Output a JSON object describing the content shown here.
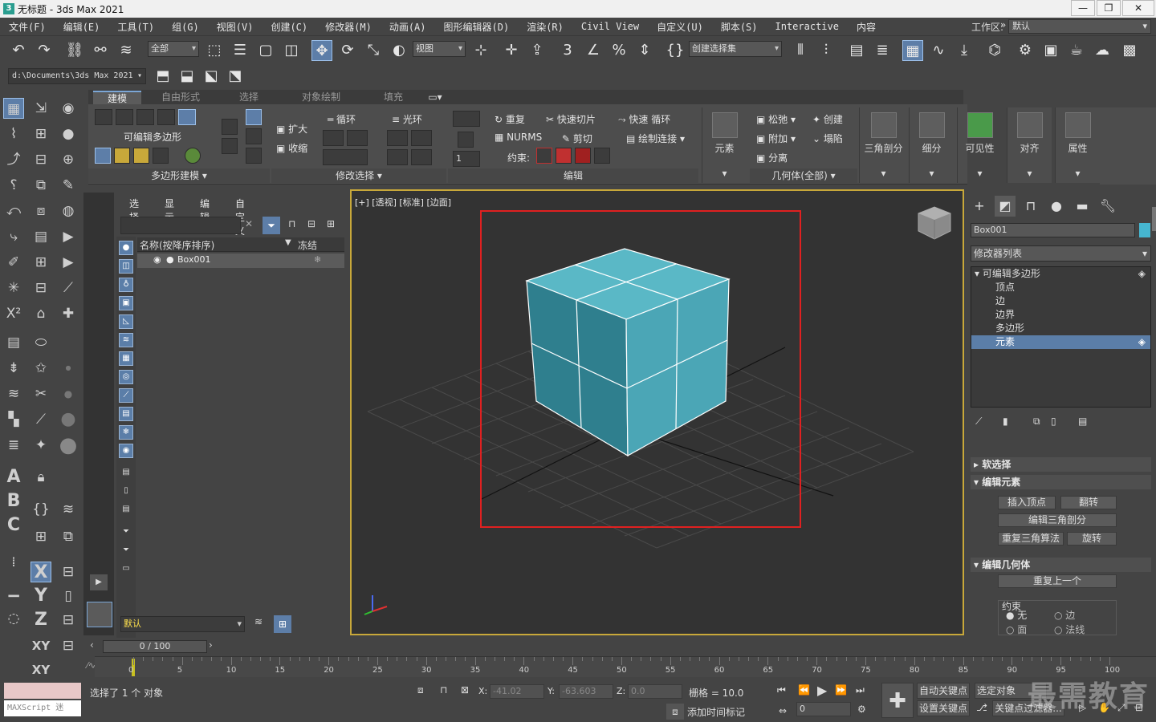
{
  "window": {
    "title": "无标题 - 3ds Max 2021",
    "minimize": "—",
    "maximize": "❐",
    "close": "✕"
  },
  "menu": {
    "items": [
      "文件(F)",
      "编辑(E)",
      "工具(T)",
      "组(G)",
      "视图(V)",
      "创建(C)",
      "修改器(M)",
      "动画(A)",
      "图形编辑器(D)",
      "渲染(R)",
      "Civil View",
      "自定义(U)",
      "脚本(S)",
      "Interactive",
      "内容"
    ],
    "more": "»",
    "workspace_label": "工作区:",
    "workspace_value": "默认"
  },
  "toolbar": {
    "selection_filter": "全部",
    "ref_coord": "视图",
    "named_selection": "创建选择集",
    "project_path": "d:\\Documents\\3ds Max 2021"
  },
  "ribbon": {
    "tabs": [
      "建模",
      "自由形式",
      "选择",
      "对象绘制",
      "填充"
    ],
    "active_tab": "建模",
    "editable_poly": "可编辑多边形",
    "panels": {
      "poly_modeling": "多边形建模 ▾",
      "modify_selection": "修改选择 ▾",
      "edit": "编辑",
      "geometry_all": "几何体(全部) ▾"
    },
    "buttons": {
      "grow": "扩大",
      "shrink": "收缩",
      "loop": "循环",
      "ring": "光环",
      "repeat": "重复",
      "nurms": "NURMS",
      "quickslice": "快速切片",
      "cut": "剪切",
      "swiftloop": "快速 循环",
      "paint_connect": "绘制连接",
      "constraint": "约束:",
      "relax": "松弛",
      "create": "创建",
      "attach": "附加",
      "collapse": "塌陷",
      "detach": "分离",
      "element": "元素",
      "tessellate": "三角剖分",
      "subdivide": "细分",
      "visibility": "可见性",
      "align": "对齐",
      "properties": "属性",
      "spinner_value": "1"
    }
  },
  "left_tools": {
    "letters": [
      "A",
      "B",
      "C",
      "X",
      "Y",
      "Z",
      "XY",
      "XY"
    ]
  },
  "scene_explorer": {
    "menu": [
      "选择",
      "显示",
      "编辑",
      "自定义"
    ],
    "column_name": "名称(按降序排序)",
    "column_freeze": "冻结",
    "row": "Box001",
    "layer": "默认"
  },
  "viewport": {
    "label": "[+] [透视] [标准] [边面]"
  },
  "command_panel": {
    "object_name": "Box001",
    "object_color": "#46b6d0",
    "modifier_list": "修改器列表",
    "stack": [
      "可编辑多边形",
      "顶点",
      "边",
      "边界",
      "多边形",
      "元素"
    ],
    "selected_index": 5,
    "rollouts": {
      "soft_selection": "软选择",
      "edit_elements": "编辑元素",
      "edit_geometry": "编辑几何体"
    },
    "buttons": {
      "insert_vertex": "插入顶点",
      "flip": "翻转",
      "edit_tri": "编辑三角剖分",
      "retriangulate": "重复三角算法",
      "turn": "旋转",
      "repeat_last": "重复上一个"
    },
    "constraints": {
      "label": "约束",
      "options": [
        "无",
        "边",
        "面",
        "法线"
      ]
    }
  },
  "timeline": {
    "frame_display": "0 / 100",
    "ticks": [
      "0",
      "5",
      "10",
      "15",
      "20",
      "25",
      "30",
      "35",
      "40",
      "45",
      "50",
      "55",
      "60",
      "65",
      "70",
      "75",
      "80",
      "85",
      "90",
      "95",
      "100"
    ]
  },
  "status": {
    "maxscript": "MAXScript 迷",
    "selection": "选择了 1 个 对象",
    "x_label": "X:",
    "x": "-41.02",
    "y_label": "Y:",
    "y": "-63.603",
    "z_label": "Z:",
    "z": "0.0",
    "grid": "栅格 = 10.0",
    "add_time_tag": "添加时间标记",
    "auto_key": "自动关键点",
    "selected_object": "选定对象",
    "set_key": "设置关键点",
    "key_filters": "关键点过滤器...",
    "frame": "0",
    "watermark": "最需教育"
  }
}
